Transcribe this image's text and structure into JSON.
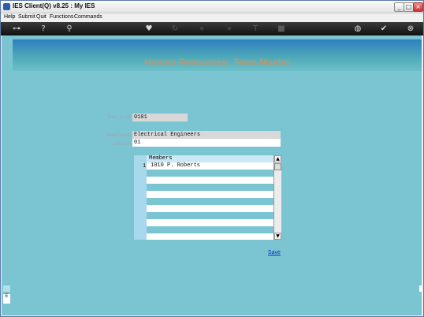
{
  "window": {
    "title": "IES Client(Q) v8.25 : My IES",
    "controls": {
      "minimize": "_",
      "maximize": "□",
      "close": "×"
    }
  },
  "menu": [
    "Help",
    "Submit",
    "Quit",
    "Functions",
    "Commands"
  ],
  "toolbar": {
    "icons": [
      "key-icon",
      "help-icon",
      "search-icon",
      "heart-icon",
      "refresh-icon",
      "first-icon",
      "last-icon",
      "font-icon",
      "stop-icon",
      "globe-icon",
      "check-icon",
      "close-icon"
    ]
  },
  "page": {
    "title": "Human Resources: Team Master"
  },
  "form": {
    "team_code": {
      "label": "Team Code",
      "value": "0101"
    },
    "team_name": {
      "label": "Team Name",
      "value": "Electrical Engineers"
    },
    "division": {
      "label": "Division",
      "value": "01"
    }
  },
  "members_grid": {
    "header": "Members",
    "rows": [
      {
        "num": "1",
        "value": "1010 P. Roberts"
      }
    ]
  },
  "actions": {
    "save": "Save"
  },
  "colors": {
    "background": "#7bc5d3",
    "title": "#b49a76",
    "link": "#0a2dcc"
  }
}
